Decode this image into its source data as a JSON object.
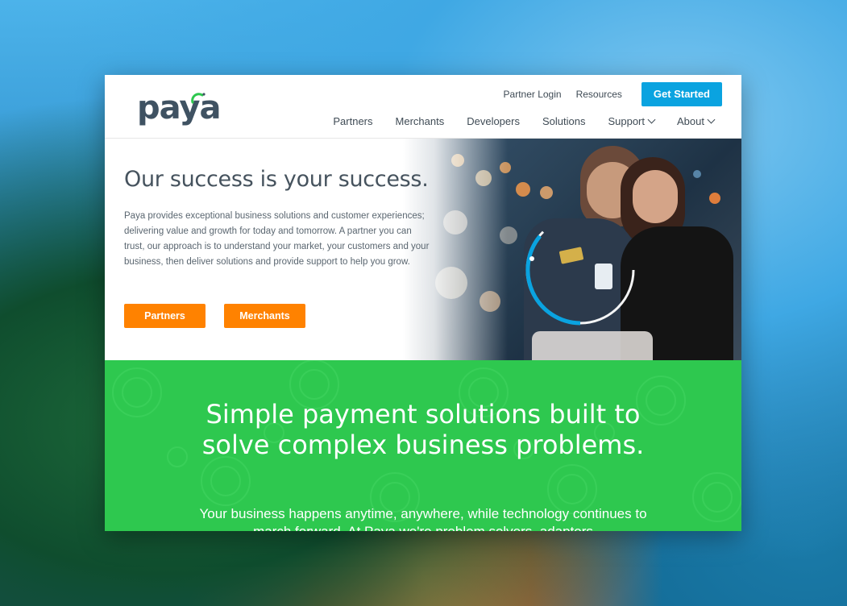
{
  "header": {
    "logo_text": "paya",
    "top_links": [
      "Partner Login",
      "Resources"
    ],
    "cta_label": "Get Started",
    "nav": [
      {
        "label": "Partners",
        "dropdown": false
      },
      {
        "label": "Merchants",
        "dropdown": false
      },
      {
        "label": "Developers",
        "dropdown": false
      },
      {
        "label": "Solutions",
        "dropdown": false
      },
      {
        "label": "Support",
        "dropdown": true
      },
      {
        "label": "About",
        "dropdown": true
      }
    ]
  },
  "hero": {
    "title": "Our success is your success.",
    "description": "Paya provides exceptional business solutions and customer experiences; delivering value and growth for today and tomorrow. A partner you can trust, our approach is to understand your market, your customers and your business, then deliver solutions and provide support to help you grow.",
    "buttons": [
      "Partners",
      "Merchants"
    ]
  },
  "banner": {
    "title": "Simple payment solutions built to solve complex business problems.",
    "subtitle": "Your business happens anytime, anywhere, while technology continues to march forward. At Paya we're problem solvers, adaptors"
  },
  "colors": {
    "brand_blue": "#0aa3e0",
    "brand_orange": "#ff8200",
    "brand_green": "#2ec84f",
    "text_dark": "#46535e"
  }
}
